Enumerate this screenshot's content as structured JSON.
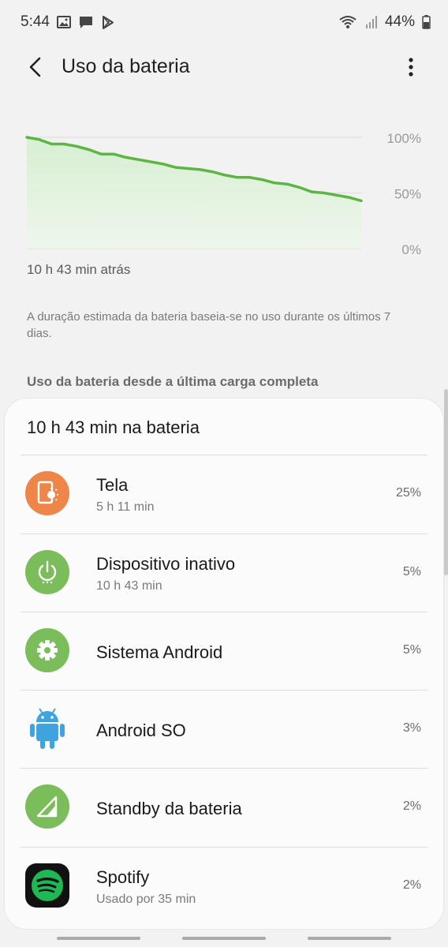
{
  "status_bar": {
    "time": "5:44",
    "battery_percent": "44%"
  },
  "app_bar": {
    "title": "Uso da bateria"
  },
  "chart_data": {
    "type": "area",
    "ylim": [
      0,
      100
    ],
    "y_ticks": [
      "100%",
      "50%",
      "0%"
    ],
    "x_label": "10 h 43 min atrás",
    "series": [
      {
        "values": [
          100,
          98,
          94,
          94,
          92,
          89,
          85,
          85,
          82,
          80,
          78,
          76,
          73,
          72,
          71,
          69,
          66,
          64,
          64,
          62,
          59,
          58,
          55,
          51,
          50,
          48,
          46,
          43
        ]
      }
    ],
    "colors": {
      "line": "#5cb643",
      "fill_top": "#d7efd2",
      "fill_bottom": "#eef6ec",
      "grid": "#dcdcdc"
    }
  },
  "note": "A duração estimada da bateria baseia-se no uso durante os últimos 7 dias.",
  "section_header": "Uso da bateria desde a última carga completa",
  "card": {
    "title": "10 h 43 min na bateria",
    "items": [
      {
        "name": "Tela",
        "sub": "5 h 11 min",
        "pct": "25%",
        "icon": "screen-brightness-icon",
        "color": "#ee8549"
      },
      {
        "name": "Dispositivo inativo",
        "sub": "10 h 43 min",
        "pct": "5%",
        "icon": "power-idle-icon",
        "color": "#7bbd5a"
      },
      {
        "name": "Sistema Android",
        "sub": "",
        "pct": "5%",
        "icon": "gear-icon",
        "color": "#7bbd5a"
      },
      {
        "name": "Android SO",
        "sub": "",
        "pct": "3%",
        "icon": "android-robot-icon",
        "color": "#3fa3df"
      },
      {
        "name": "Standby da bateria",
        "sub": "",
        "pct": "2%",
        "icon": "signal-standby-icon",
        "color": "#7bbd5a"
      },
      {
        "name": "Spotify",
        "sub": "Usado por 35 min",
        "pct": "2%",
        "icon": "spotify-icon",
        "color": "#1db954"
      }
    ]
  }
}
